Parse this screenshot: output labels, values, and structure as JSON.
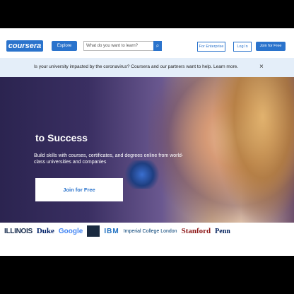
{
  "header": {
    "logo": "coursera",
    "explore_label": "Explore",
    "search_placeholder": "What do you want to learn?",
    "search_icon": "search-icon",
    "enterprise_label": "For Enterprise",
    "login_label": "Log In",
    "join_label": "Join for Free"
  },
  "banner": {
    "text": "Is your university impacted by the coronavirus? Coursera and our partners want to help. Learn more.",
    "close": "×"
  },
  "hero": {
    "title": "to Success",
    "subtitle": "Build skills with courses, certificates, and degrees online from world-class universities and companies",
    "cta": "Join for Free"
  },
  "partners": [
    "ILLINOIS",
    "Duke",
    "Google",
    "IBM",
    "Imperial College London",
    "Stanford",
    "Penn"
  ]
}
